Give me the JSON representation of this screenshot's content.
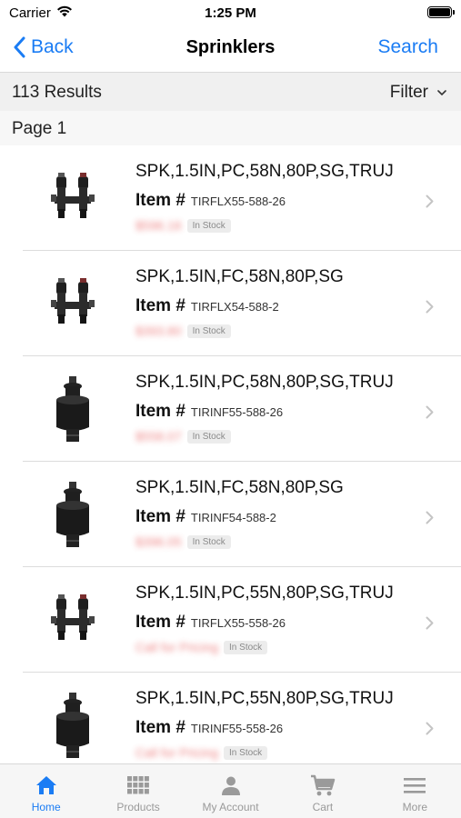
{
  "status_bar": {
    "carrier": "Carrier",
    "time": "1:25 PM"
  },
  "nav": {
    "back_label": "Back",
    "title": "Sprinklers",
    "search_label": "Search"
  },
  "results": {
    "count_text": "113 Results",
    "filter_label": "Filter"
  },
  "page": {
    "label": "Page 1"
  },
  "item_label": "Item #",
  "products": [
    {
      "name": "SPK,1.5IN,PC,58N,80P,SG,TRUJ",
      "item_number": "TIRFLX55-588-26",
      "price": "$596.16",
      "stock": "In Stock",
      "image": "twin-head-sprinkler"
    },
    {
      "name": "SPK,1.5IN,FC,58N,80P,SG",
      "item_number": "TIRFLX54-588-2",
      "price": "$393.80",
      "stock": "In Stock",
      "image": "twin-head-sprinkler"
    },
    {
      "name": "SPK,1.5IN,PC,58N,80P,SG,TRUJ",
      "item_number": "TIRINF55-588-26",
      "price": "$558.07",
      "stock": "In Stock",
      "image": "black-rotor-sprinkler"
    },
    {
      "name": "SPK,1.5IN,FC,58N,80P,SG",
      "item_number": "TIRINF54-588-2",
      "price": "$396.05",
      "stock": "In Stock",
      "image": "black-rotor-sprinkler"
    },
    {
      "name": "SPK,1.5IN,PC,55N,80P,SG,TRUJ",
      "item_number": "TIRFLX55-558-26",
      "price": "Call for Pricing",
      "stock": "In Stock",
      "image": "twin-head-sprinkler"
    },
    {
      "name": "SPK,1.5IN,PC,55N,80P,SG,TRUJ",
      "item_number": "TIRINF55-558-26",
      "price": "Call for Pricing",
      "stock": "In Stock",
      "image": "black-rotor-sprinkler"
    }
  ],
  "tabs": [
    {
      "label": "Home",
      "icon": "home-icon",
      "active": true
    },
    {
      "label": "Products",
      "icon": "grid-icon",
      "active": false
    },
    {
      "label": "My Account",
      "icon": "person-icon",
      "active": false
    },
    {
      "label": "Cart",
      "icon": "cart-icon",
      "active": false
    },
    {
      "label": "More",
      "icon": "menu-icon",
      "active": false
    }
  ],
  "colors": {
    "accent": "#1a7cf4",
    "results_bg": "#f0f0f0",
    "price_blur": "#e85b5b"
  }
}
